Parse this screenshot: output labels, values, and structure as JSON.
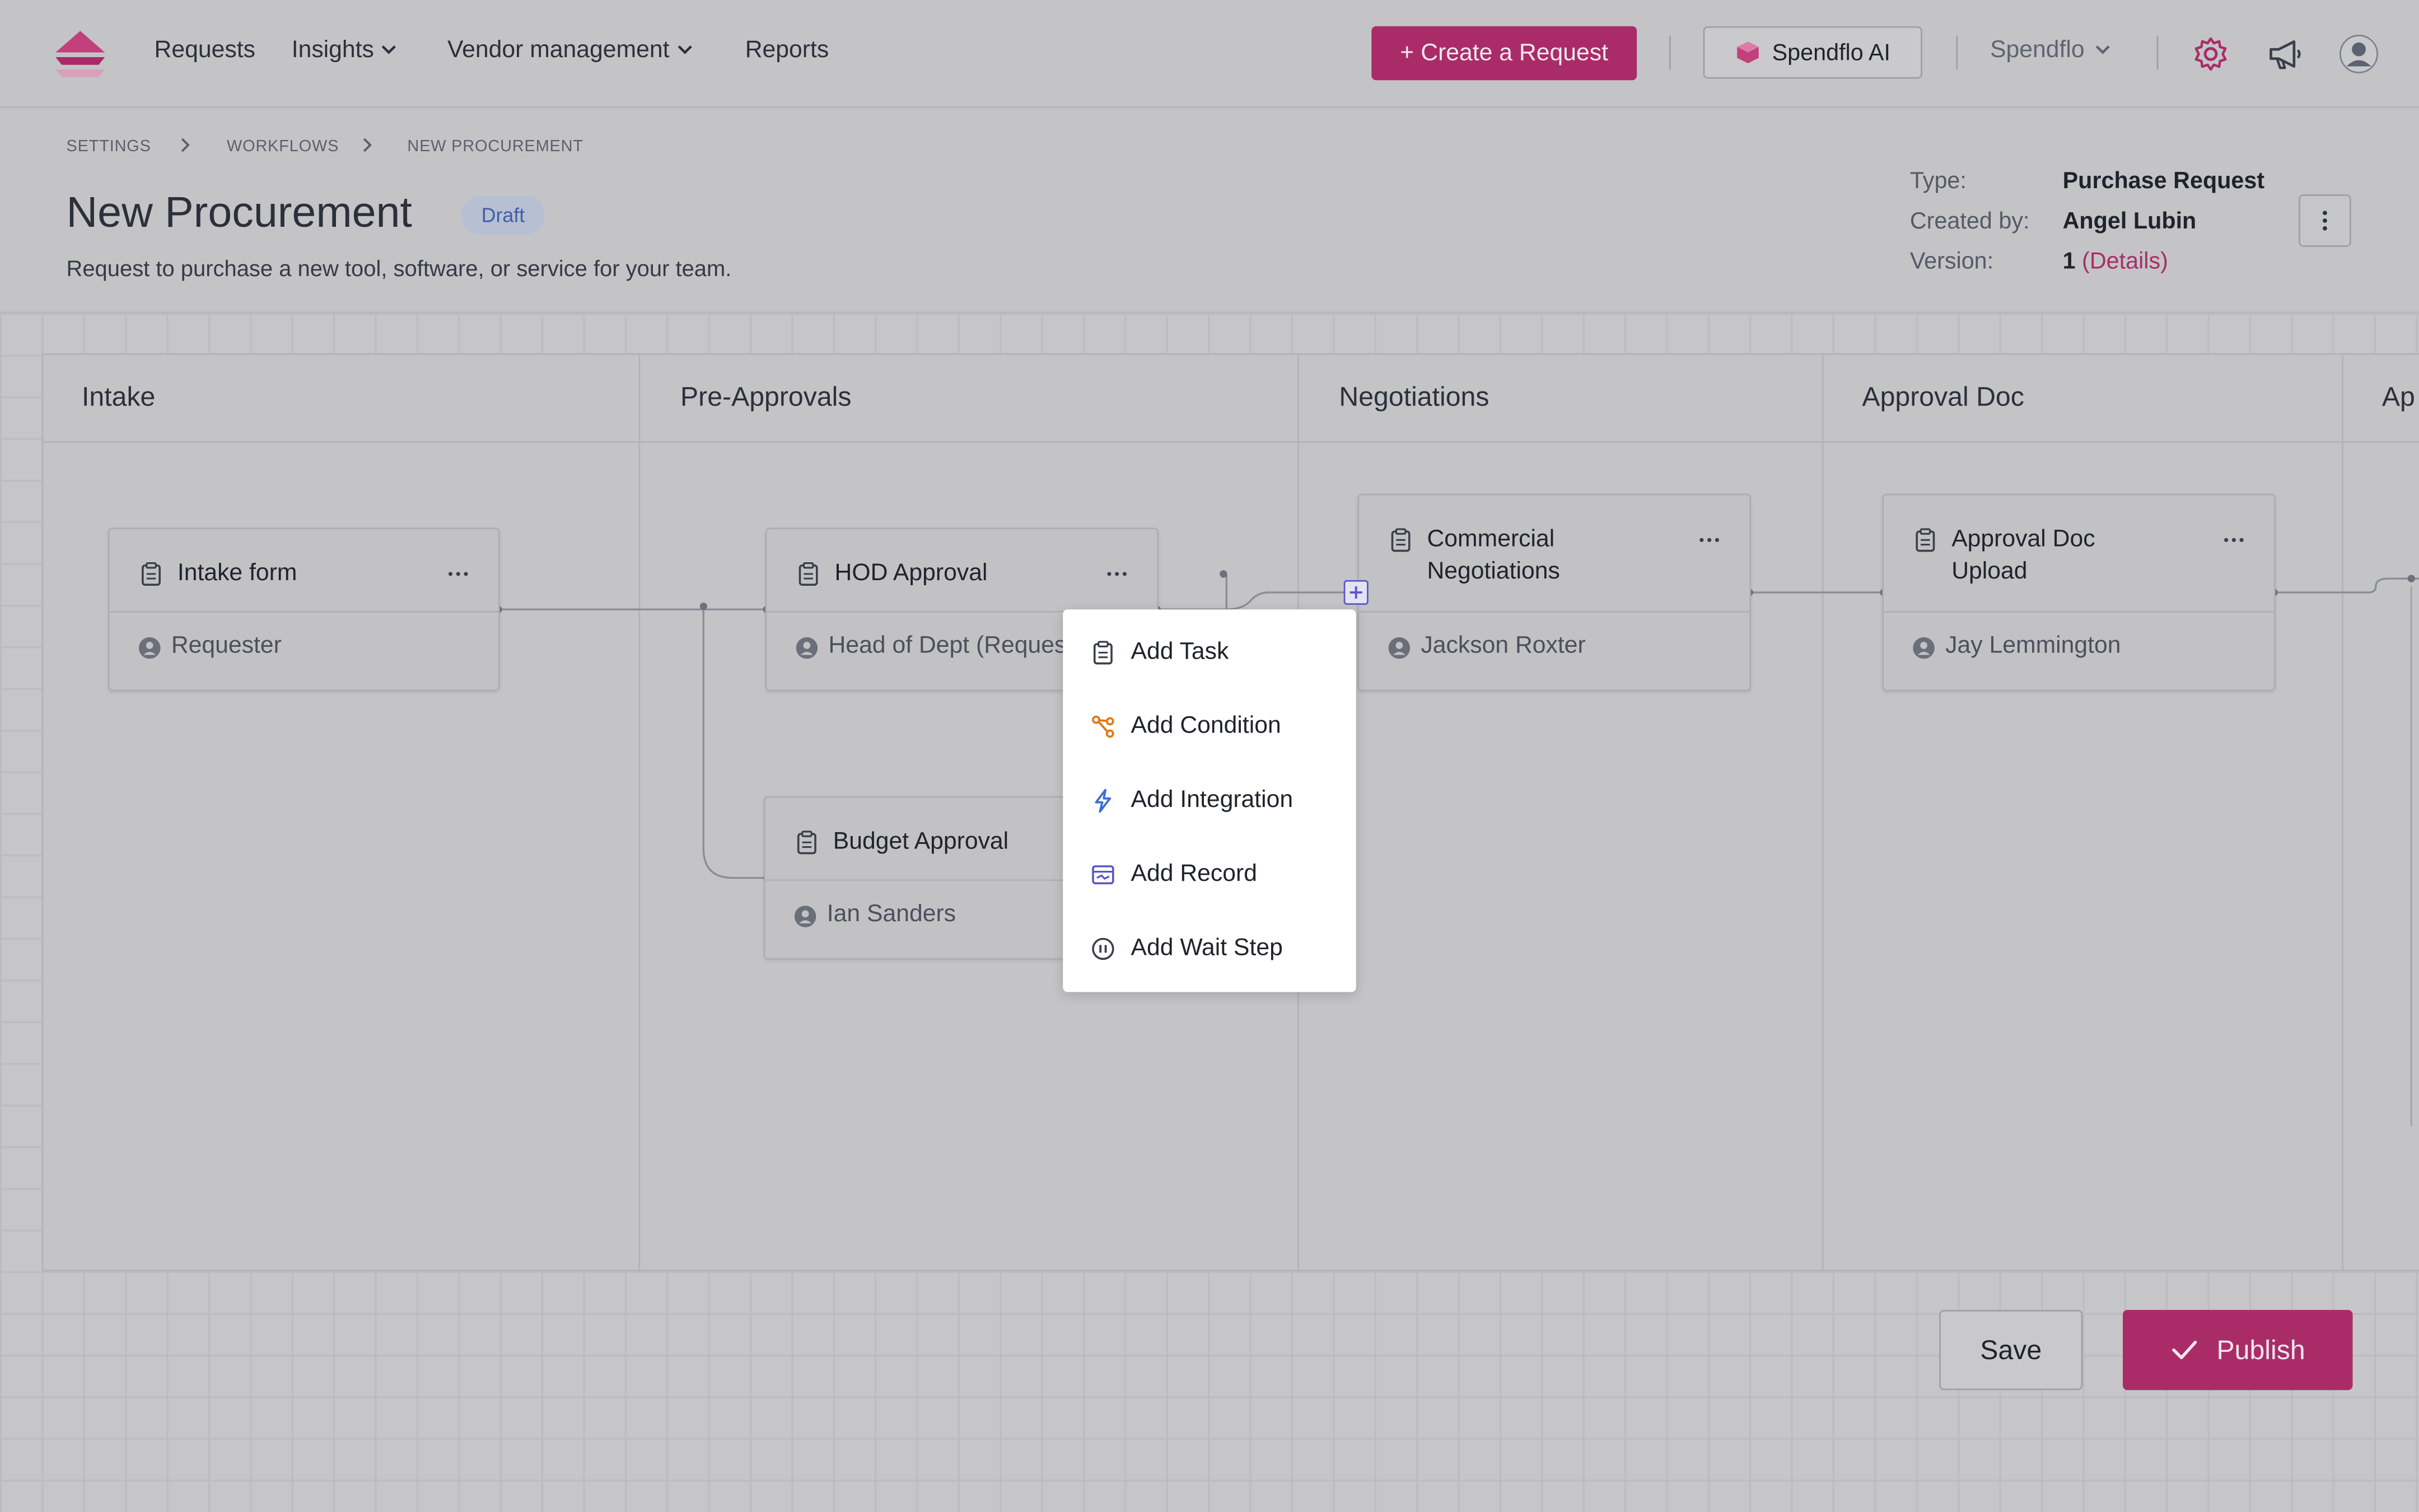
{
  "nav": {
    "links": [
      "Requests",
      "Insights",
      "Vendor management",
      "Reports"
    ],
    "create_label": "+ Create a Request",
    "ai_label": "Spendflo AI",
    "org_label": "Spendflo"
  },
  "breadcrumb": [
    "SETTINGS",
    "WORKFLOWS",
    "NEW PROCUREMENT"
  ],
  "header": {
    "title": "New Procurement",
    "status": "Draft",
    "description": "Request to purchase a new tool, software, or service for your team.",
    "type_label": "Type:",
    "type_value": "Purchase Request",
    "created_label": "Created by:",
    "created_value": "Angel Lubin",
    "version_label": "Version:",
    "version_value": "1",
    "version_link": "(Details)"
  },
  "columns": [
    "Intake",
    "Pre-Approvals",
    "Negotiations",
    "Approval Doc",
    "Ap"
  ],
  "cards": {
    "intake": {
      "title": "Intake form",
      "user": "Requester"
    },
    "hod": {
      "title": "HOD Approval",
      "user": "Head of Dept (Requester)"
    },
    "budget": {
      "title": "Budget Approval",
      "user": "Ian Sanders"
    },
    "commercial": {
      "title_line1": "Commercial",
      "title_line2": "Negotiations",
      "user": "Jackson Roxter"
    },
    "approvaldoc": {
      "title_line1": "Approval Doc",
      "title_line2": "Upload",
      "user": "Jay Lemmington"
    }
  },
  "menu": {
    "items": [
      {
        "label": "Add Task",
        "icon": "clipboard-icon"
      },
      {
        "label": "Add Condition",
        "icon": "branch-icon"
      },
      {
        "label": "Add Integration",
        "icon": "lightning-icon"
      },
      {
        "label": "Add Record",
        "icon": "record-icon"
      },
      {
        "label": "Add Wait Step",
        "icon": "pause-icon"
      }
    ]
  },
  "footer": {
    "save_label": "Save",
    "publish_label": "Publish"
  },
  "colors": {
    "brand": "#a92c68",
    "accent": "#5a56c9",
    "condition": "#e07b1a",
    "integration": "#3b6fd9"
  }
}
